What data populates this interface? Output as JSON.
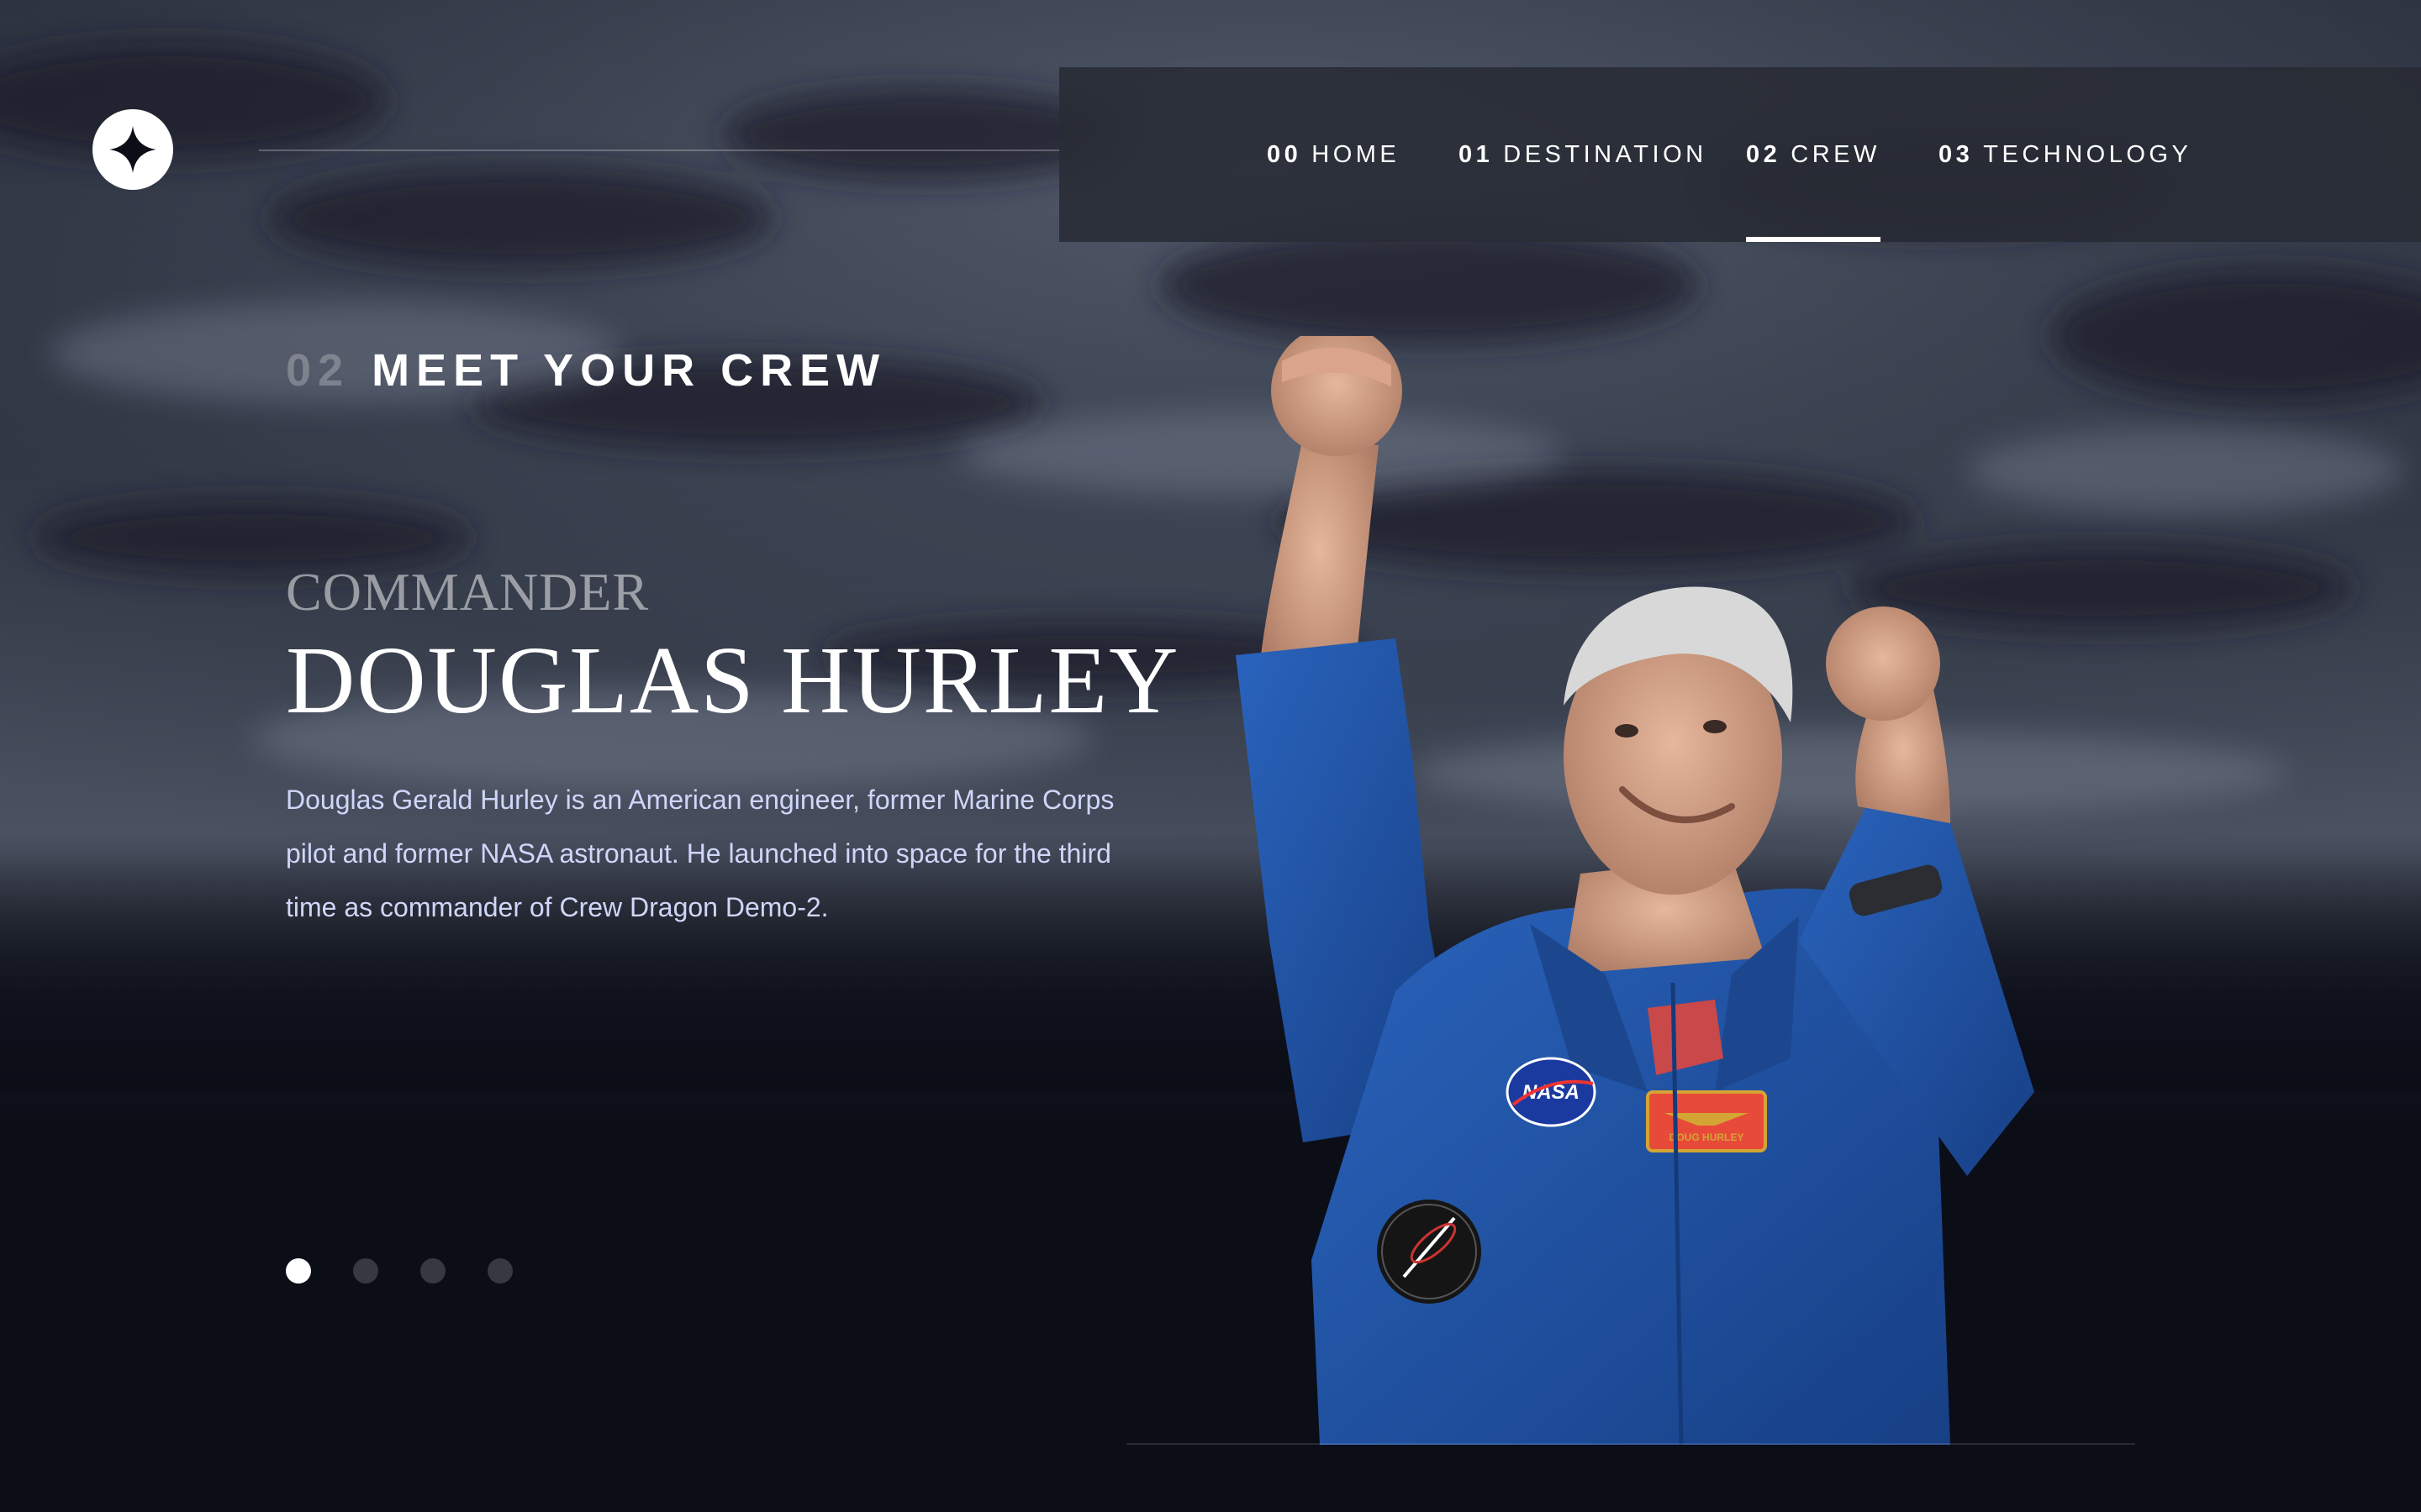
{
  "nav": {
    "items": [
      {
        "num": "00",
        "label": "HOME"
      },
      {
        "num": "01",
        "label": "DESTINATION"
      },
      {
        "num": "02",
        "label": "CREW"
      },
      {
        "num": "03",
        "label": "TECHNOLOGY"
      }
    ],
    "active_index": 2
  },
  "section": {
    "num": "02",
    "title": "MEET YOUR CREW"
  },
  "crew": {
    "role": "COMMANDER",
    "name": "DOUGLAS HURLEY",
    "bio": "Douglas Gerald Hurley is an American engineer, former Marine Corps pilot and former NASA astronaut. He launched into space for the third time as commander of Crew Dragon Demo-2."
  },
  "pagination": {
    "count": 4,
    "active_index": 0
  },
  "patch": {
    "name_tag": "DOUG HURLEY",
    "nasa": "NASA"
  },
  "colors": {
    "background": "#0b0d17",
    "text": "#ffffff",
    "body_text": "#d0d6f9",
    "suit_blue": "#1f55a8"
  }
}
